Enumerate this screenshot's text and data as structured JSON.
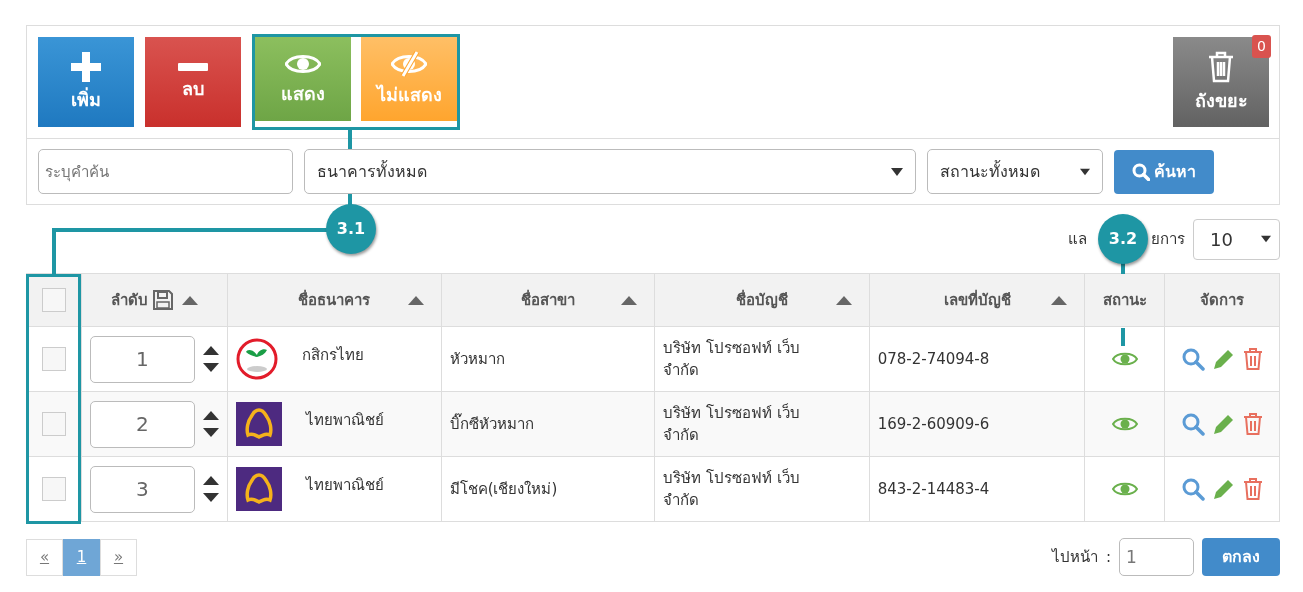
{
  "toolbar": {
    "buttons": [
      {
        "kind": "add",
        "label": "เพิ่ม"
      },
      {
        "kind": "remove",
        "label": "ลบ"
      },
      {
        "kind": "show",
        "label": "แสดง"
      },
      {
        "kind": "hide",
        "label": "ไม่แสดง"
      }
    ],
    "trash": {
      "label": "ถังขยะ",
      "count": "0"
    }
  },
  "filters": {
    "search": {
      "placeholder": "ระบุคำค้น"
    },
    "bank": "ธนาคารทั้งหมด",
    "status": "สถานะทั้งหมด",
    "search_button": "ค้นหา"
  },
  "page_size": {
    "label_start": "แล",
    "label_end": "ยการ",
    "value": "10"
  },
  "table": {
    "all_checked": false,
    "columns": [
      {
        "kind": "check",
        "sortable": false
      },
      {
        "kind": "order",
        "label": "ลำดับ",
        "sortable": true
      },
      {
        "kind": "text",
        "label": "ชื่อธนาคาร",
        "sortable": true
      },
      {
        "kind": "text",
        "label": "ชื่อสาขา",
        "sortable": true
      },
      {
        "kind": "text",
        "label": "ชื่อบัญชี",
        "sortable": true
      },
      {
        "kind": "text",
        "label": "เลขที่บัญชี",
        "sortable": true
      },
      {
        "kind": "text",
        "label": "สถานะ",
        "sortable": false
      },
      {
        "kind": "text",
        "label": "จัดการ",
        "sortable": false
      }
    ],
    "rows": [
      {
        "checked": false,
        "order": "1",
        "kind": "leaf",
        "bank": "กสิกรไทย",
        "branch": "หัวหมาก",
        "account_name": "บริษัท โปรซอฟท์ เว็บ จำกัด",
        "account_no": "078-2-74094-8",
        "visible": true
      },
      {
        "checked": false,
        "order": "2",
        "kind": "bell",
        "bank": "ไทยพาณิชย์",
        "branch": "บิ๊กซีหัวหมาก",
        "account_name": "บริษัท โปรซอฟท์ เว็บ จำกัด",
        "account_no": "169-2-60909-6",
        "visible": true
      },
      {
        "checked": false,
        "order": "3",
        "kind": "bell",
        "bank": "ไทยพาณิชย์",
        "branch": "มีโชค(เชียงใหม่)",
        "account_name": "บริษัท โปรซอฟท์ เว็บ จำกัด",
        "account_no": "843-2-14483-4",
        "visible": true
      }
    ]
  },
  "pagination": {
    "pages": [
      {
        "label": "«",
        "selected": false
      },
      {
        "label": "1",
        "selected": true
      },
      {
        "label": "»",
        "selected": false
      }
    ],
    "goto_label": "ไปหน้า",
    "separator": ":",
    "goto_value": "1",
    "goto_button": "ตกลง"
  },
  "callouts": [
    {
      "label": "3.1"
    },
    {
      "label": "3.2"
    }
  ]
}
